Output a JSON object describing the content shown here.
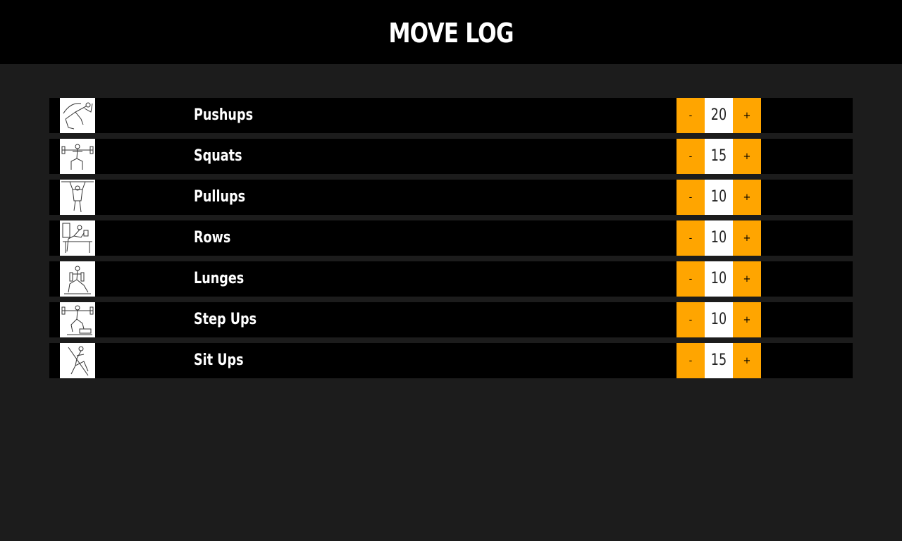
{
  "app": {
    "title": "MOVE LOG"
  },
  "colors": {
    "header_bg": "#000000",
    "page_bg": "#1c1c1c",
    "accent": "#ffa500",
    "row_bg": "#000000",
    "text": "#ffffff"
  },
  "exercises": [
    {
      "name": "Pushups",
      "count": "20",
      "minus_label": "-",
      "plus_label": "+",
      "icon": "pushups-icon"
    },
    {
      "name": "Squats",
      "count": "15",
      "minus_label": "-",
      "plus_label": "+",
      "icon": "squats-icon"
    },
    {
      "name": "Pullups",
      "count": "10",
      "minus_label": "-",
      "plus_label": "+",
      "icon": "pullups-icon"
    },
    {
      "name": "Rows",
      "count": "10",
      "minus_label": "-",
      "plus_label": "+",
      "icon": "rows-icon"
    },
    {
      "name": "Lunges",
      "count": "10",
      "minus_label": "-",
      "plus_label": "+",
      "icon": "lunges-icon"
    },
    {
      "name": "Step Ups",
      "count": "10",
      "minus_label": "-",
      "plus_label": "+",
      "icon": "step-ups-icon"
    },
    {
      "name": "Sit Ups",
      "count": "15",
      "minus_label": "-",
      "plus_label": "+",
      "icon": "sit-ups-icon"
    }
  ]
}
